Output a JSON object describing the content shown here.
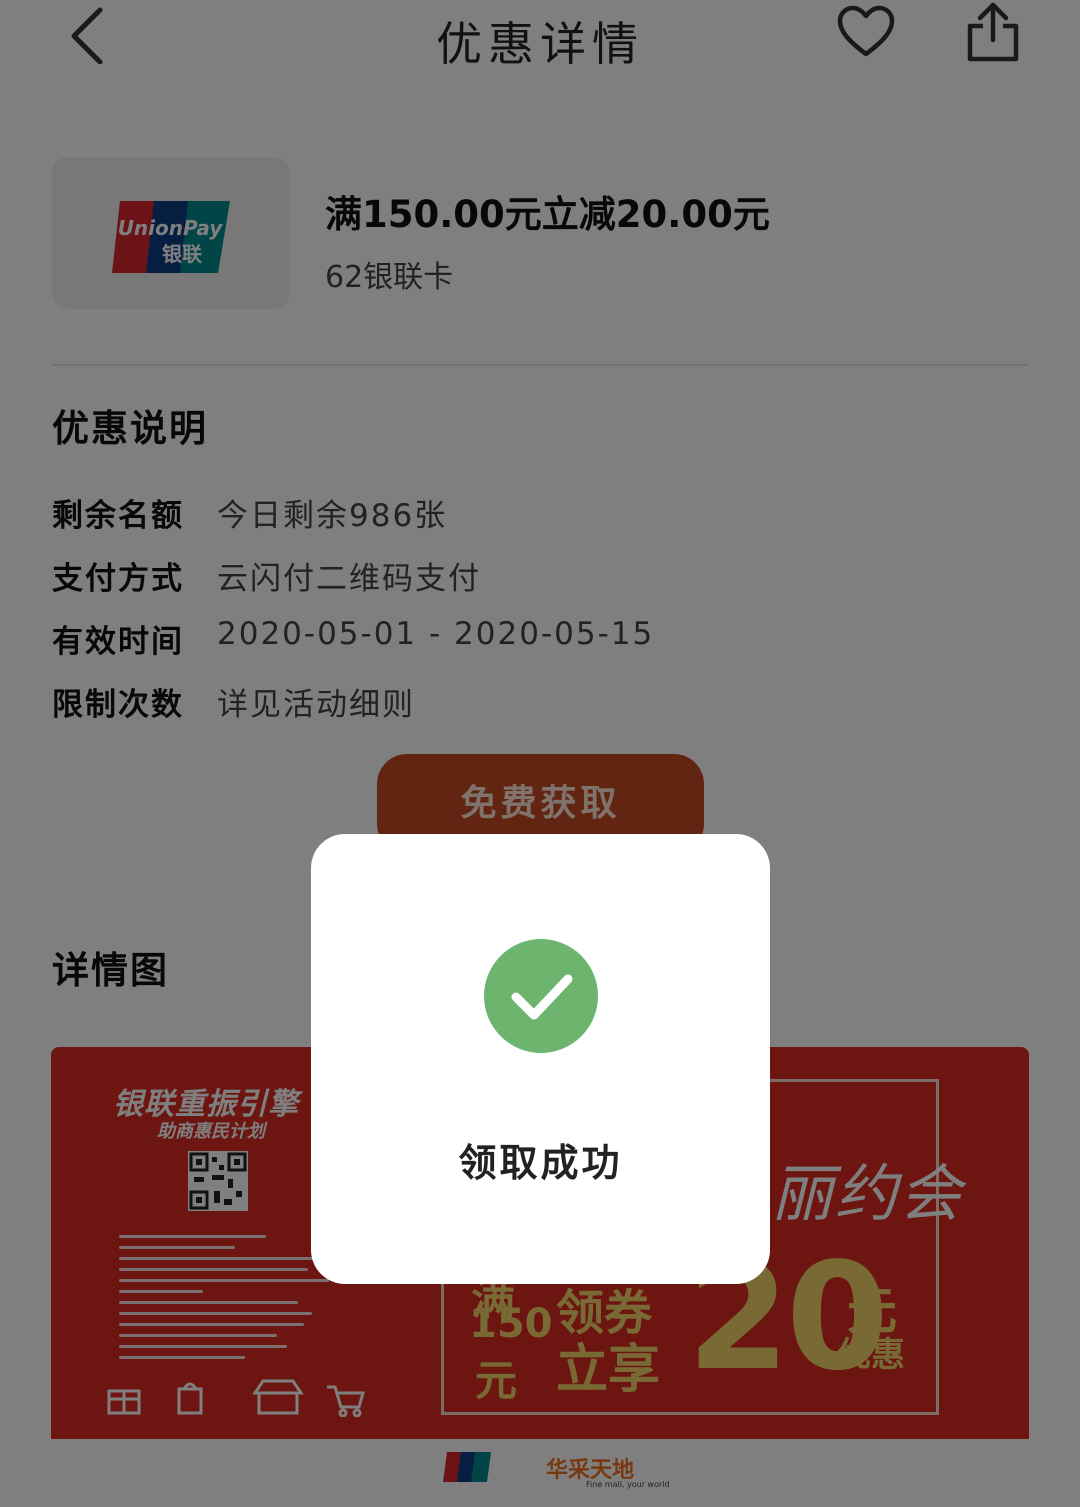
{
  "header": {
    "title": "优惠详情",
    "back_icon": "chevron-left-icon",
    "favorite_icon": "heart-outline-icon",
    "share_icon": "share-icon"
  },
  "coupon": {
    "card_logo_text_en": "UnionPay",
    "card_logo_text_cn": "银联",
    "title": "满150.00元立减20.00元",
    "subtitle": "62银联卡"
  },
  "offer_section": {
    "title": "优惠说明",
    "rows": [
      {
        "label": "剩余名额",
        "value": "今日剩余986张"
      },
      {
        "label": "支付方式",
        "value": "云闪付二维码支付"
      },
      {
        "label": "有效时间",
        "value": "2020-05-01 - 2020-05-15"
      },
      {
        "label": "限制次数",
        "value": "详见活动细则"
      }
    ]
  },
  "get_button_label": "免费获取",
  "detail_section": {
    "title": "详情图"
  },
  "poster": {
    "left_title": "银联重振引擎",
    "left_subtitle": "助商惠民计划",
    "right_title_partial": "丽约会",
    "man": "满",
    "amount_150": "150",
    "yuan_left": "元",
    "coupon_text": "领券",
    "share_text": "立享",
    "amount_20": "20",
    "yuan_right": "元",
    "discount_text": "优惠",
    "footer_brand": "华采天地",
    "footer_brand_sub": "Fine mall, your world"
  },
  "dialog": {
    "icon": "check-circle-icon",
    "message": "领取成功",
    "accent_color": "#6db56f"
  },
  "colors": {
    "button_bg": "#c24a24",
    "poster_bg": "#d82a22",
    "poster_gold": "#f3d56b"
  }
}
